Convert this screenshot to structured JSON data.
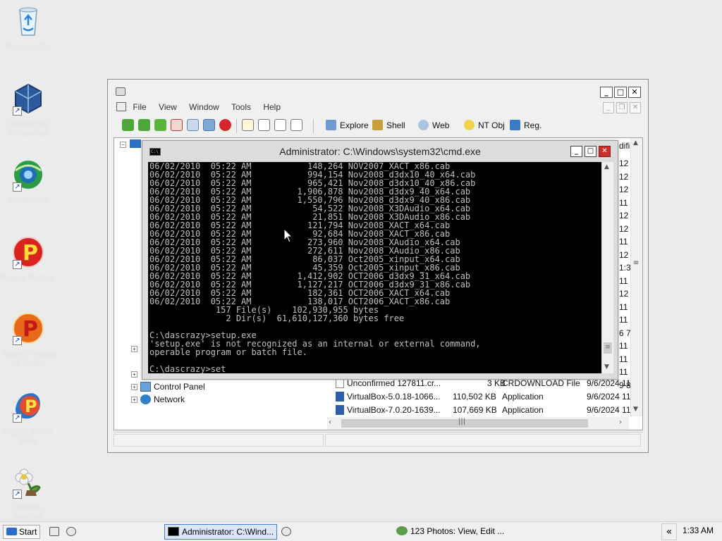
{
  "desktop": {
    "icons": [
      {
        "label": "Recycle Bin"
      },
      {
        "label": "Oracle VM\nVirtualBox"
      },
      {
        "label": "KeyWizard"
      },
      {
        "label": "Puppy Photos"
      },
      {
        "label": "Puppy Photos\nof Youth"
      },
      {
        "label": "Puppy Photo\nView"
      },
      {
        "label": "Flowers\nGarden"
      }
    ]
  },
  "explorer": {
    "menu": [
      "File",
      "View",
      "Window",
      "Tools",
      "Help"
    ],
    "toolbar": {
      "explore": "Explore",
      "shell": "Shell",
      "web": "Web",
      "ntobj": "NT Obj",
      "reg": "Reg."
    },
    "column_header_fragment": "difi",
    "tree": [
      {
        "label": "Control Panel"
      },
      {
        "label": "Network"
      }
    ],
    "right_col_fragments": [
      "12",
      "12",
      "12",
      "11",
      "12",
      "12",
      "11",
      "12",
      "1:3",
      "11",
      "12",
      "11",
      "11",
      "6 7",
      "11",
      "11",
      "11",
      "9 8"
    ],
    "files": [
      {
        "name": "Unconfirmed 127811.cr...",
        "size": "3 KB",
        "type": "CRDOWNLOAD File",
        "date": "9/6/2024 11"
      },
      {
        "name": "VirtualBox-5.0.18-1066...",
        "size": "110,502 KB",
        "type": "Application",
        "date": "9/6/2024 11"
      },
      {
        "name": "VirtualBox-7.0.20-1639...",
        "size": "107,669 KB",
        "type": "Application",
        "date": "9/6/2024 11"
      }
    ]
  },
  "cmd": {
    "title": "Administrator: C:\\Windows\\system32\\cmd.exe",
    "icon_text": "C:\\",
    "lines": [
      "06/02/2010  05:22 AM           148,264 NOV2007_XACT_x86.cab",
      "06/02/2010  05:22 AM           994,154 Nov2008_d3dx10_40_x64.cab",
      "06/02/2010  05:22 AM           965,421 Nov2008_d3dx10_40_x86.cab",
      "06/02/2010  05:22 AM         1,906,878 Nov2008_d3dx9_40_x64.cab",
      "06/02/2010  05:22 AM         1,550,796 Nov2008_d3dx9_40_x86.cab",
      "06/02/2010  05:22 AM            54,522 Nov2008_X3DAudio_x64.cab",
      "06/02/2010  05:22 AM            21,851 Nov2008_X3DAudio_x86.cab",
      "06/02/2010  05:22 AM           121,794 Nov2008_XACT_x64.cab",
      "06/02/2010  05:22 AM            92,684 Nov2008_XACT_x86.cab",
      "06/02/2010  05:22 AM           273,960 Nov2008_XAudio_x64.cab",
      "06/02/2010  05:22 AM           272,611 Nov2008_XAudio_x86.cab",
      "06/02/2010  05:22 AM            86,037 Oct2005_xinput_x64.cab",
      "06/02/2010  05:22 AM            45,359 Oct2005_xinput_x86.cab",
      "06/02/2010  05:22 AM         1,412,902 OCT2006_d3dx9_31_x64.cab",
      "06/02/2010  05:22 AM         1,127,217 OCT2006_d3dx9_31_x86.cab",
      "06/02/2010  05:22 AM           182,361 OCT2006_XACT_x64.cab",
      "06/02/2010  05:22 AM           138,017 OCT2006_XACT_x86.cab",
      "             157 File(s)    102,930,955 bytes",
      "               2 Dir(s)  61,610,127,360 bytes free",
      "",
      "C:\\dascrazy>setup.exe",
      "'setup.exe' is not recognized as an internal or external command,",
      "operable program or batch file.",
      "",
      "C:\\dascrazy>set"
    ]
  },
  "taskbar": {
    "start_label": "Start",
    "tasks": [
      {
        "label": "Administrator: C:\\Wind..."
      },
      {
        "label": "123 Photos: View, Edit  ..."
      }
    ],
    "tray_arrow": "«",
    "clock": "1:33 AM"
  }
}
